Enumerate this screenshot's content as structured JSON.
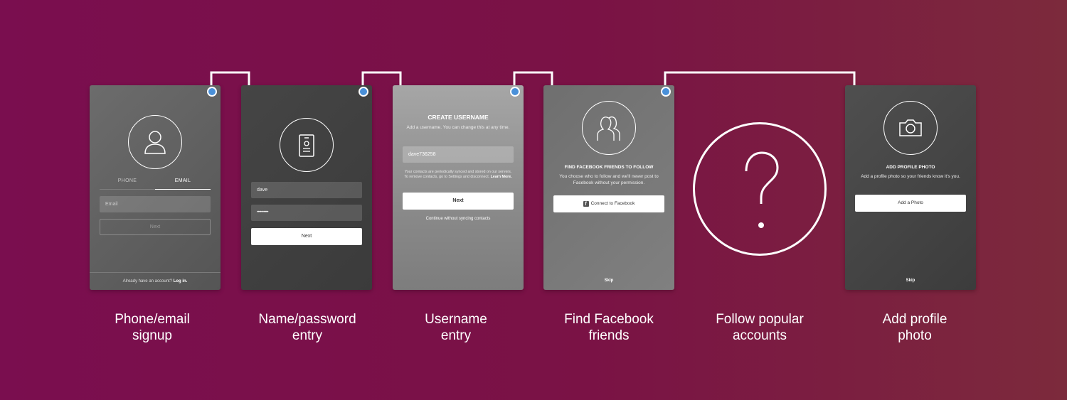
{
  "screens": {
    "phone_email": {
      "tab_phone": "PHONE",
      "tab_email": "EMAIL",
      "email_placeholder": "Email",
      "next_label": "Next",
      "footer_text": "Already have an account?",
      "footer_link": "Log in."
    },
    "name_password": {
      "name_value": "dave",
      "password_value": "••••••••••",
      "next_label": "Next"
    },
    "username": {
      "title": "CREATE USERNAME",
      "description": "Add a username. You can change this at any time.",
      "username_value": "dave736258",
      "sync_note": "Your contacts are periodically synced and stored on our servers. To remove contacts, go to Settings and disconnect.",
      "learn_more": "Learn More.",
      "next_label": "Next",
      "continue_link": "Continue without syncing contacts"
    },
    "facebook": {
      "title": "FIND FACEBOOK FRIENDS TO FOLLOW",
      "description": "You choose who to follow and we'll never post to Facebook without your permission.",
      "connect_label": "Connect to Facebook",
      "skip_label": "Skip"
    },
    "profile_photo": {
      "title": "ADD PROFILE PHOTO",
      "description": "Add a profile photo so your friends know it's you.",
      "add_label": "Add a Photo",
      "skip_label": "Skip"
    }
  },
  "captions": {
    "phone_email": [
      "Phone/email",
      "signup"
    ],
    "name_password": [
      "Name/password",
      "entry"
    ],
    "username": [
      "Username",
      "entry"
    ],
    "facebook": [
      "Find Facebook",
      "friends"
    ],
    "follow": [
      "Follow popular",
      "accounts"
    ],
    "profile_photo": [
      "Add profile",
      "photo"
    ]
  },
  "colors": {
    "dot": "#4a90d9",
    "connector": "#ffffff"
  },
  "icons": [
    "user-icon",
    "id-badge-icon",
    "friends-icon",
    "question-mark-icon",
    "camera-icon",
    "facebook-icon"
  ]
}
